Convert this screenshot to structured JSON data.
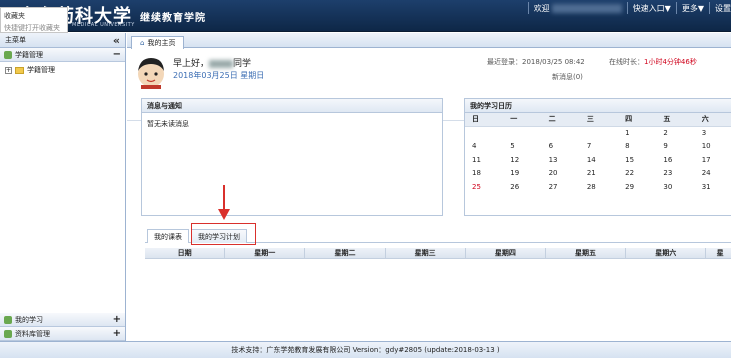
{
  "header": {
    "logo_cn": "广东药科大学",
    "logo_en": "MEDICAL UNIVERSITY",
    "subtitle": "继续教育学院",
    "welcome": "欢迎",
    "quick_entry": "快速入口▼",
    "more": "更多▼",
    "settings": "设置"
  },
  "favorites_popup": {
    "title": "收藏夹",
    "hint": "快捷键打开收藏夹"
  },
  "sidebar": {
    "title": "主菜单",
    "collapse": "«",
    "sections": [
      {
        "label": "学籍管理",
        "toggle": "−"
      },
      {
        "label": "我的学习",
        "toggle": "+"
      },
      {
        "label": "资料库管理",
        "toggle": "+"
      }
    ],
    "tree_item": "学籍管理"
  },
  "main": {
    "tab_label": "我的主页",
    "greeting_prefix": "早上好，",
    "greeting_suffix": "同学",
    "date": "2018年03月25日 星期日",
    "last_login": "最近登录：2018/03/25 08:42",
    "new_msg": "新消息(0)",
    "online_label": "在线时长：",
    "online_value": "1小时4分钟46秒"
  },
  "messages": {
    "title": "消息与通知",
    "empty": "暂无未读消息"
  },
  "calendar": {
    "title": "我的学习日历",
    "weekdays": [
      "日",
      "一",
      "二",
      "三",
      "四",
      "五",
      "六"
    ],
    "rows": [
      [
        "",
        "",
        "",
        "",
        "1",
        "2",
        "3"
      ],
      [
        "4",
        "5",
        "6",
        "7",
        "8",
        "9",
        "10"
      ],
      [
        "11",
        "12",
        "13",
        "14",
        "15",
        "16",
        "17"
      ],
      [
        "18",
        "19",
        "20",
        "21",
        "22",
        "23",
        "24"
      ],
      [
        "25",
        "26",
        "27",
        "28",
        "29",
        "30",
        "31"
      ]
    ],
    "today": "25"
  },
  "schedule": {
    "tabs": [
      "我的课表",
      "我的学习计划"
    ],
    "columns": [
      "日期",
      "星期一",
      "星期二",
      "星期三",
      "星期四",
      "星期五",
      "星期六",
      "星"
    ]
  },
  "footer": {
    "text": "技术支持：广东学苑教育发展有限公司 Version：gdy#2805 (update:2018-03-13 )"
  },
  "colors": {
    "header_bg": "#1d3f6c",
    "accent_blue": "#3b6db3",
    "red": "#d9302c"
  }
}
